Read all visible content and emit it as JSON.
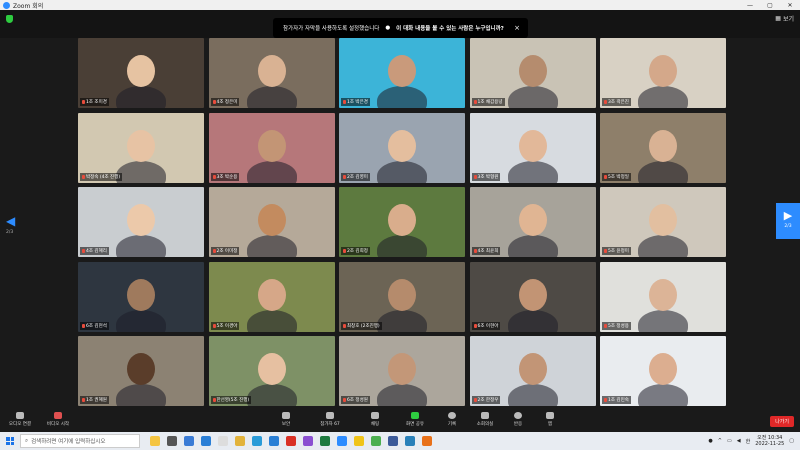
{
  "window": {
    "title": "Zoom 회의",
    "min": "—",
    "max": "▢",
    "close": "✕"
  },
  "header": {
    "view_label": "보기"
  },
  "banner": {
    "text1": "참가자가 자막을 사용하도록 설정했습니다",
    "text2": "이 대화 내용을 볼 수 있는 사람은 누구입니까?",
    "close": "×"
  },
  "nav": {
    "left_page": "2/3",
    "right_page": "2/3",
    "left_arrow": "◀",
    "right_arrow": "▶"
  },
  "participants": [
    {
      "name": "1조 조미경",
      "bg": "#4a3f36",
      "skin": "#e6c3a2"
    },
    {
      "name": "4조 정은미",
      "bg": "#7a6d5e",
      "skin": "#d9b293"
    },
    {
      "name": "1조 박은경",
      "bg": "#3cb4d8",
      "skin": "#c99a7b"
    },
    {
      "name": "1조 채갑용녕",
      "bg": "#c9c3b5",
      "skin": "#b58c6e"
    },
    {
      "name": "3조 곽은진",
      "bg": "#d8d1c4",
      "skin": "#d4a88a"
    },
    {
      "name": "박정숙 (4조 진행)",
      "bg": "#d2c8b1",
      "skin": "#e7c3a4"
    },
    {
      "name": "3조 박순용",
      "bg": "#b6777a",
      "skin": "#c39575"
    },
    {
      "name": "2조 김영미",
      "bg": "#9aa4b0",
      "skin": "#e4be9e"
    },
    {
      "name": "3조 박형원",
      "bg": "#d7dbe0",
      "skin": "#e2b899"
    },
    {
      "name": "5조 박정일",
      "bg": "#8e7f6a",
      "skin": "#d9b294"
    },
    {
      "name": "4조 김혜리",
      "bg": "#c9cdd0",
      "skin": "#ecc9aa"
    },
    {
      "name": "2조 이미정",
      "bg": "#b5a999",
      "skin": "#c38b5f"
    },
    {
      "name": "2조 김희정",
      "bg": "#5d7a3f",
      "skin": "#d9ad8c"
    },
    {
      "name": "4조 최윤희",
      "bg": "#a7a39a",
      "skin": "#e0b593"
    },
    {
      "name": "5조 윤정미",
      "bg": "#cfc8bc",
      "skin": "#e2bfa0"
    },
    {
      "name": "6조 김현석",
      "bg": "#2e3640",
      "skin": "#9f7a5d"
    },
    {
      "name": "5조 이경아",
      "bg": "#7d8a4e",
      "skin": "#d6a788"
    },
    {
      "name": "최창호 (2조진행)",
      "bg": "#6c6455",
      "skin": "#b58b6c"
    },
    {
      "name": "6조 이현아",
      "bg": "#4e4a45",
      "skin": "#c29474"
    },
    {
      "name": "5조 정성용",
      "bg": "#e0e0dc",
      "skin": "#dcb497"
    },
    {
      "name": "1조 권혜원",
      "bg": "#8c8273",
      "skin": "#5a3d2a"
    },
    {
      "name": "한선영(5조 진행)",
      "bg": "#7e9166",
      "skin": "#e6c0a1"
    },
    {
      "name": "6조 정성원",
      "bg": "#aca69c",
      "skin": "#c39778"
    },
    {
      "name": "2조 한정우",
      "bg": "#cfd3d8",
      "skin": "#c29576"
    },
    {
      "name": "1조 김민숙",
      "bg": "#e9ecef",
      "skin": "#dcae90"
    }
  ],
  "toolbar": {
    "audio": "오디오 연결",
    "video": "비디오 시작",
    "security": "보안",
    "participants": "참가자",
    "participant_count": "67",
    "chat": "채팅",
    "share": "화면 공유",
    "record": "기록",
    "rooms": "소회의실",
    "reactions": "반응",
    "apps": "앱",
    "leave": "나가기"
  },
  "taskbar": {
    "search_placeholder": "검색하려면 여기에 입력하십시오",
    "time_period": "오전 10:34",
    "date": "2022-11-25",
    "lang": "한"
  },
  "colors": {
    "accent": "#2d8cff",
    "leave": "#e02828",
    "muted": "#e74c3c"
  }
}
